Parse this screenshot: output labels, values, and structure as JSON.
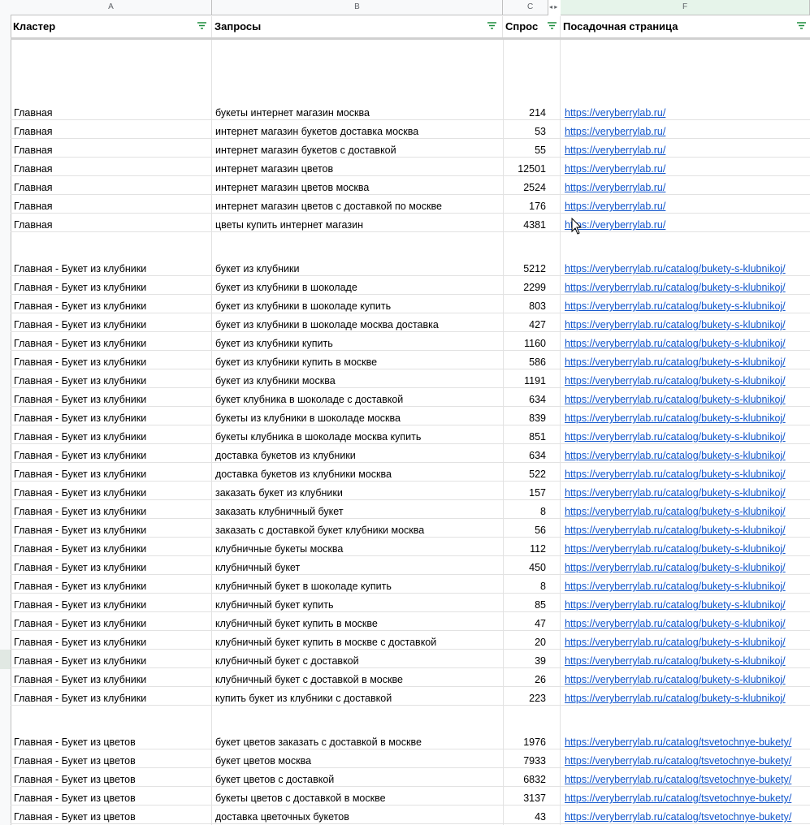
{
  "columns": [
    "A",
    "B",
    "C",
    "F"
  ],
  "headers": {
    "cluster": "Кластер",
    "queries": "Запросы",
    "demand": "Спрос",
    "landing": "Посадочная страница"
  },
  "icons": {
    "filter": "filter-icon",
    "col_arrows": "◂ ▸"
  },
  "colors": {
    "link": "#1155cc",
    "filter": "#1e8e3e",
    "selection": "#e6f4ea"
  },
  "rows": [
    {
      "blank": true,
      "height": 76
    },
    {
      "a": "Главная",
      "b": "букеты интернет магазин москва",
      "c": "214",
      "f": "https://veryberrylab.ru/"
    },
    {
      "a": "Главная",
      "b": "интернет магазин букетов доставка москва",
      "c": "53",
      "f": "https://veryberrylab.ru/"
    },
    {
      "a": "Главная",
      "b": "интернет магазин букетов с доставкой",
      "c": "55",
      "f": "https://veryberrylab.ru/"
    },
    {
      "a": "Главная",
      "b": "интернет магазин цветов",
      "c": "12501",
      "f": "https://veryberrylab.ru/"
    },
    {
      "a": "Главная",
      "b": "интернет магазин цветов москва",
      "c": "2524",
      "f": "https://veryberrylab.ru/"
    },
    {
      "a": "Главная",
      "b": "интернет магазин цветов с доставкой по москве",
      "c": "176",
      "f": "https://veryberrylab.ru/"
    },
    {
      "a": "Главная",
      "b": "цветы купить интернет магазин",
      "c": "4381",
      "f": "https://veryberrylab.ru/"
    },
    {
      "blank": true,
      "height": 31
    },
    {
      "a": "Главная - Букет из клубники",
      "b": "букет из клубники",
      "c": "5212",
      "f": "https://veryberrylab.ru/catalog/bukety-s-klubnikoj/"
    },
    {
      "a": "Главная - Букет из клубники",
      "b": "букет из клубники в шоколаде",
      "c": "2299",
      "f": "https://veryberrylab.ru/catalog/bukety-s-klubnikoj/"
    },
    {
      "a": "Главная - Букет из клубники",
      "b": "букет из клубники в шоколаде купить",
      "c": "803",
      "f": "https://veryberrylab.ru/catalog/bukety-s-klubnikoj/"
    },
    {
      "a": "Главная - Букет из клубники",
      "b": "букет из клубники в шоколаде москва доставка",
      "c": "427",
      "f": "https://veryberrylab.ru/catalog/bukety-s-klubnikoj/"
    },
    {
      "a": "Главная - Букет из клубники",
      "b": "букет из клубники купить",
      "c": "1160",
      "f": "https://veryberrylab.ru/catalog/bukety-s-klubnikoj/"
    },
    {
      "a": "Главная - Букет из клубники",
      "b": "букет из клубники купить в москве",
      "c": "586",
      "f": "https://veryberrylab.ru/catalog/bukety-s-klubnikoj/"
    },
    {
      "a": "Главная - Букет из клубники",
      "b": "букет из клубники москва",
      "c": "1191",
      "f": "https://veryberrylab.ru/catalog/bukety-s-klubnikoj/"
    },
    {
      "a": "Главная - Букет из клубники",
      "b": "букет клубника в шоколаде с доставкой",
      "c": "634",
      "f": "https://veryberrylab.ru/catalog/bukety-s-klubnikoj/"
    },
    {
      "a": "Главная - Букет из клубники",
      "b": "букеты из клубники в шоколаде москва",
      "c": "839",
      "f": "https://veryberrylab.ru/catalog/bukety-s-klubnikoj/"
    },
    {
      "a": "Главная - Букет из клубники",
      "b": "букеты клубника в шоколаде москва купить",
      "c": "851",
      "f": "https://veryberrylab.ru/catalog/bukety-s-klubnikoj/"
    },
    {
      "a": "Главная - Букет из клубники",
      "b": "доставка букетов из клубники",
      "c": "634",
      "f": "https://veryberrylab.ru/catalog/bukety-s-klubnikoj/"
    },
    {
      "a": "Главная - Букет из клубники",
      "b": "доставка букетов из клубники москва",
      "c": "522",
      "f": "https://veryberrylab.ru/catalog/bukety-s-klubnikoj/"
    },
    {
      "a": "Главная - Букет из клубники",
      "b": "заказать букет из клубники",
      "c": "157",
      "f": "https://veryberrylab.ru/catalog/bukety-s-klubnikoj/"
    },
    {
      "a": "Главная - Букет из клубники",
      "b": "заказать клубничный букет",
      "c": "8",
      "f": "https://veryberrylab.ru/catalog/bukety-s-klubnikoj/"
    },
    {
      "a": "Главная - Букет из клубники",
      "b": "заказать с доставкой букет клубники москва",
      "c": "56",
      "f": "https://veryberrylab.ru/catalog/bukety-s-klubnikoj/"
    },
    {
      "a": "Главная - Букет из клубники",
      "b": "клубничные букеты москва",
      "c": "112",
      "f": "https://veryberrylab.ru/catalog/bukety-s-klubnikoj/"
    },
    {
      "a": "Главная - Букет из клубники",
      "b": "клубничный букет",
      "c": "450",
      "f": "https://veryberrylab.ru/catalog/bukety-s-klubnikoj/"
    },
    {
      "a": "Главная - Букет из клубники",
      "b": "клубничный букет в шоколаде купить",
      "c": "8",
      "f": "https://veryberrylab.ru/catalog/bukety-s-klubnikoj/"
    },
    {
      "a": "Главная - Букет из клубники",
      "b": "клубничный букет купить",
      "c": "85",
      "f": "https://veryberrylab.ru/catalog/bukety-s-klubnikoj/"
    },
    {
      "a": "Главная - Букет из клубники",
      "b": "клубничный букет купить в москве",
      "c": "47",
      "f": "https://veryberrylab.ru/catalog/bukety-s-klubnikoj/"
    },
    {
      "a": "Главная - Букет из клубники",
      "b": "клубничный букет купить в москве с доставкой",
      "c": "20",
      "f": "https://veryberrylab.ru/catalog/bukety-s-klubnikoj/"
    },
    {
      "a": "Главная - Букет из клубники",
      "b": "клубничный букет с доставкой",
      "c": "39",
      "f": "https://veryberrylab.ru/catalog/bukety-s-klubnikoj/"
    },
    {
      "a": "Главная - Букет из клубники",
      "b": "клубничный букет с доставкой в москве",
      "c": "26",
      "f": "https://veryberrylab.ru/catalog/bukety-s-klubnikoj/"
    },
    {
      "a": "Главная - Букет из клубники",
      "b": "купить букет из клубники с доставкой",
      "c": "223",
      "f": "https://veryberrylab.ru/catalog/bukety-s-klubnikoj/"
    },
    {
      "blank": true,
      "height": 31
    },
    {
      "a": "Главная - Букет из цветов",
      "b": "букет цветов заказать с доставкой в москве",
      "c": "1976",
      "f": "https://veryberrylab.ru/catalog/tsvetochnye-bukety/"
    },
    {
      "a": "Главная - Букет из цветов",
      "b": "букет цветов москва",
      "c": "7933",
      "f": "https://veryberrylab.ru/catalog/tsvetochnye-bukety/"
    },
    {
      "a": "Главная - Букет из цветов",
      "b": "букет цветов с доставкой",
      "c": "6832",
      "f": "https://veryberrylab.ru/catalog/tsvetochnye-bukety/"
    },
    {
      "a": "Главная - Букет из цветов",
      "b": "букеты цветов с доставкой в москве",
      "c": "3137",
      "f": "https://veryberrylab.ru/catalog/tsvetochnye-bukety/"
    },
    {
      "a": "Главная - Букет из цветов",
      "b": "доставка цветочных букетов",
      "c": "43",
      "f": "https://veryberrylab.ru/catalog/tsvetochnye-bukety/"
    }
  ]
}
